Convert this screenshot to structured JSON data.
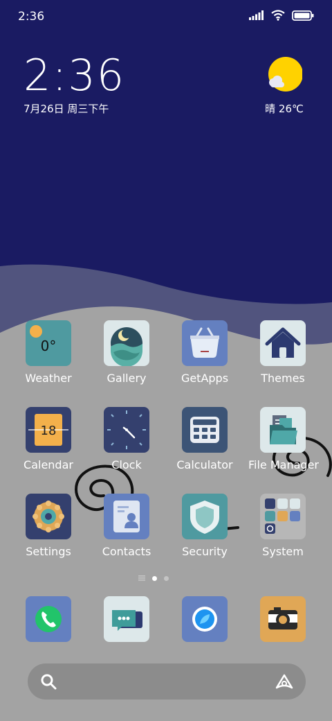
{
  "status_bar": {
    "time": "2:36",
    "icons": [
      "signal-icon",
      "wifi-icon",
      "battery-icon"
    ]
  },
  "clock_widget": {
    "time": "2:36",
    "date": "7月26日 周三下午"
  },
  "weather_widget": {
    "icon": "partly-sunny-icon",
    "text": "晴 26℃"
  },
  "apps": [
    {
      "label": "Weather",
      "icon": "weather-icon",
      "badge": "0°"
    },
    {
      "label": "Gallery",
      "icon": "gallery-icon"
    },
    {
      "label": "GetApps",
      "icon": "shopping-basket-icon"
    },
    {
      "label": "Themes",
      "icon": "house-icon"
    },
    {
      "label": "Calendar",
      "icon": "calendar-icon",
      "badge": "18"
    },
    {
      "label": "Clock",
      "icon": "clock-icon"
    },
    {
      "label": "Calculator",
      "icon": "calculator-icon"
    },
    {
      "label": "File Manager",
      "icon": "folder-icon"
    },
    {
      "label": "Settings",
      "icon": "gear-icon"
    },
    {
      "label": "Contacts",
      "icon": "contact-card-icon"
    },
    {
      "label": "Security",
      "icon": "shield-icon"
    },
    {
      "label": "System",
      "icon": "folder-grid-icon"
    }
  ],
  "page_indicator": {
    "pages": 2,
    "current": 1
  },
  "dock": [
    {
      "icon": "phone-icon"
    },
    {
      "icon": "messages-icon"
    },
    {
      "icon": "browser-icon"
    },
    {
      "icon": "camera-icon"
    }
  ],
  "search_bar": {
    "placeholder": "",
    "value": ""
  },
  "colors": {
    "sky": "#1a1b62",
    "wave": "#51547e",
    "ground": "#a3a3a3",
    "sun": "#ffd200"
  }
}
